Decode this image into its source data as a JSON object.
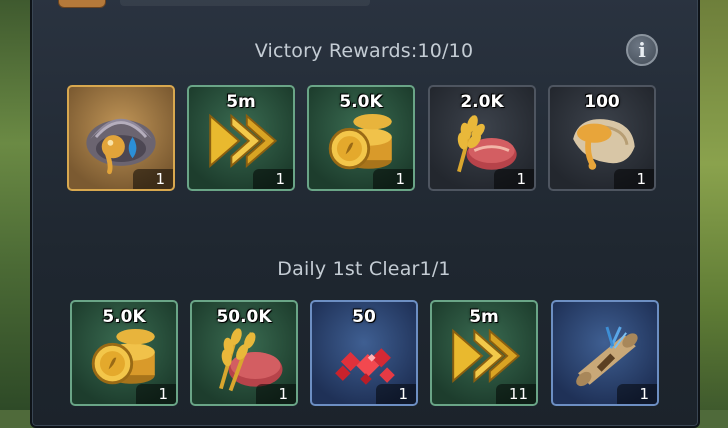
{
  "victory_section": {
    "title": "Victory Rewards:10/10",
    "items": [
      {
        "amount": "",
        "count": "1",
        "icon": "amber-shell-icon",
        "frame": "gold"
      },
      {
        "amount": "5m",
        "count": "1",
        "icon": "speedup-arrows-icon",
        "frame": "green"
      },
      {
        "amount": "5.0K",
        "count": "1",
        "icon": "gold-coins-icon",
        "frame": "green"
      },
      {
        "amount": "2.0K",
        "count": "1",
        "icon": "food-wheat-meat-icon",
        "frame": "dark"
      },
      {
        "amount": "100",
        "count": "1",
        "icon": "honey-horn-icon",
        "frame": "dark"
      }
    ]
  },
  "daily_section": {
    "title": "Daily 1st Clear1/1",
    "items": [
      {
        "amount": "5.0K",
        "count": "1",
        "icon": "gold-coins-icon",
        "frame": "green"
      },
      {
        "amount": "50.0K",
        "count": "1",
        "icon": "food-wheat-meat-icon",
        "frame": "green"
      },
      {
        "amount": "50",
        "count": "1",
        "icon": "red-gems-icon",
        "frame": "blue"
      },
      {
        "amount": "5m",
        "count": "11",
        "icon": "speedup-arrows-icon",
        "frame": "green"
      },
      {
        "amount": "",
        "count": "1",
        "icon": "scroll-feather-icon",
        "frame": "blue"
      }
    ]
  },
  "info_button": {
    "label": "i",
    "icon": "info-icon"
  }
}
